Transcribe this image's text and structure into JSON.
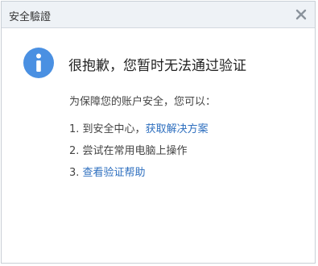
{
  "dialog": {
    "title": "安全驗證",
    "close_symbol": "×"
  },
  "message": {
    "icon": "info-icon",
    "heading": "很抱歉，您暂时无法通过验证",
    "subtext": "为保障您的账户安全，您可以："
  },
  "steps": [
    {
      "number": "1.",
      "text": "到安全中心，",
      "link": "获取解决方案"
    },
    {
      "number": "2.",
      "text": "尝试在常用电脑上操作"
    },
    {
      "number": "3.",
      "link": "查看验证帮助"
    }
  ],
  "colors": {
    "accent": "#4a90e2",
    "link": "#2e6fbf",
    "titlebar": "#eef2f6"
  }
}
